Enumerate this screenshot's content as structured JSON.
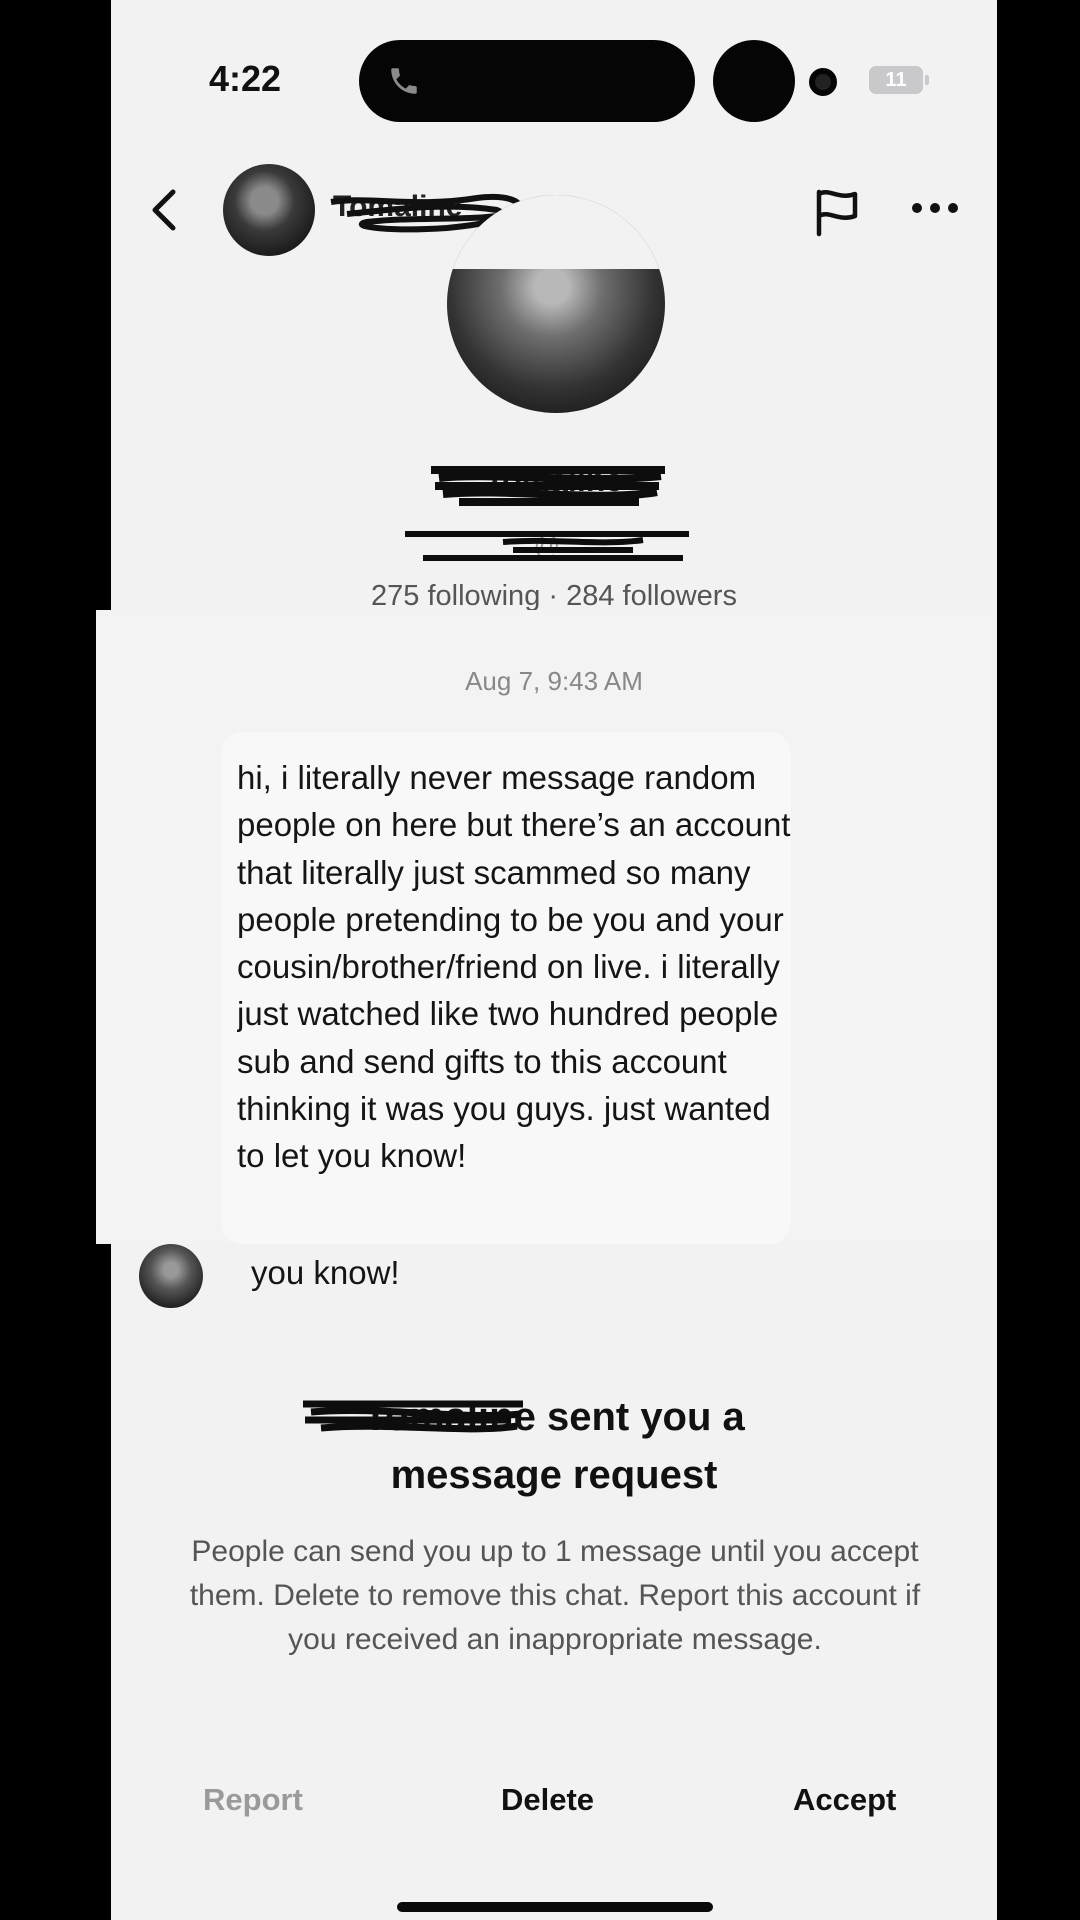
{
  "status_bar": {
    "time": "4:22",
    "battery": "11"
  },
  "header": {
    "name": "Tomaline"
  },
  "profile": {
    "name": "Tomaline",
    "handle": "@_",
    "stats": "275 following · 284 followers"
  },
  "conversation": {
    "timestamp": "Aug 7, 9:43 AM",
    "message": "hi, i literally never message random people on here but there’s an account that literally just scammed so many people pretending to be you and your cousin/brother/friend on live. i literally just watched like two hundred people sub and send gifts to this account thinking it was you guys. just wanted to let you know!",
    "message_tail": "you know!"
  },
  "request": {
    "sender": "Tomaline",
    "title_suffix": "sent you a",
    "title_line2": "message request",
    "description": "People can send you up to 1 message until you accept them. Delete to remove this chat. Report this account if you received an inappropriate message."
  },
  "actions": {
    "report": "Report",
    "delete": "Delete",
    "accept": "Accept"
  }
}
